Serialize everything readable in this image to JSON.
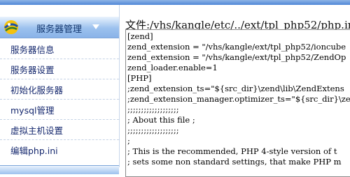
{
  "sidebar": {
    "header_title": "服务器管理",
    "items": [
      {
        "label": "服务器信息"
      },
      {
        "label": "服务器设置"
      },
      {
        "label": "初始化服务器"
      },
      {
        "label": "mysql管理"
      },
      {
        "label": "虚拟主机设置"
      },
      {
        "label": "编辑php.ini"
      }
    ]
  },
  "main": {
    "file_path": "文件:/vhs/kangle/etc/../ext/tpl_php52/php.ini",
    "editor_lines": [
      "[zend]",
      "zend_extension = \"/vhs/kangle/ext/tpl_php52/ioncube",
      "zend_extension = \"/vhs/kangle/ext/tpl_php52/ZendOp",
      "zend_loader.enable=1",
      "[PHP]",
      ";zend_extension_ts=\"${src_dir}\\zend\\lib\\ZendExtens",
      ";zend_extension_manager.optimizer_ts=\"${src_dir}\\ze",
      ";;;;;;;;;;;;;;;;;;;",
      "; About this file ;",
      ";;;;;;;;;;;;;;;;;;;",
      ";",
      "; This is the recommended, PHP 4-style version of t",
      "; sets some non standard settings, that make PHP m"
    ]
  },
  "colors": {
    "header_gradient": "#9cc1ee",
    "link_text": "#15286e",
    "top_strip": "#4f86d6"
  },
  "icons": {
    "logo": "kangle-logo-icon",
    "collapse": "triangle-down-icon"
  }
}
